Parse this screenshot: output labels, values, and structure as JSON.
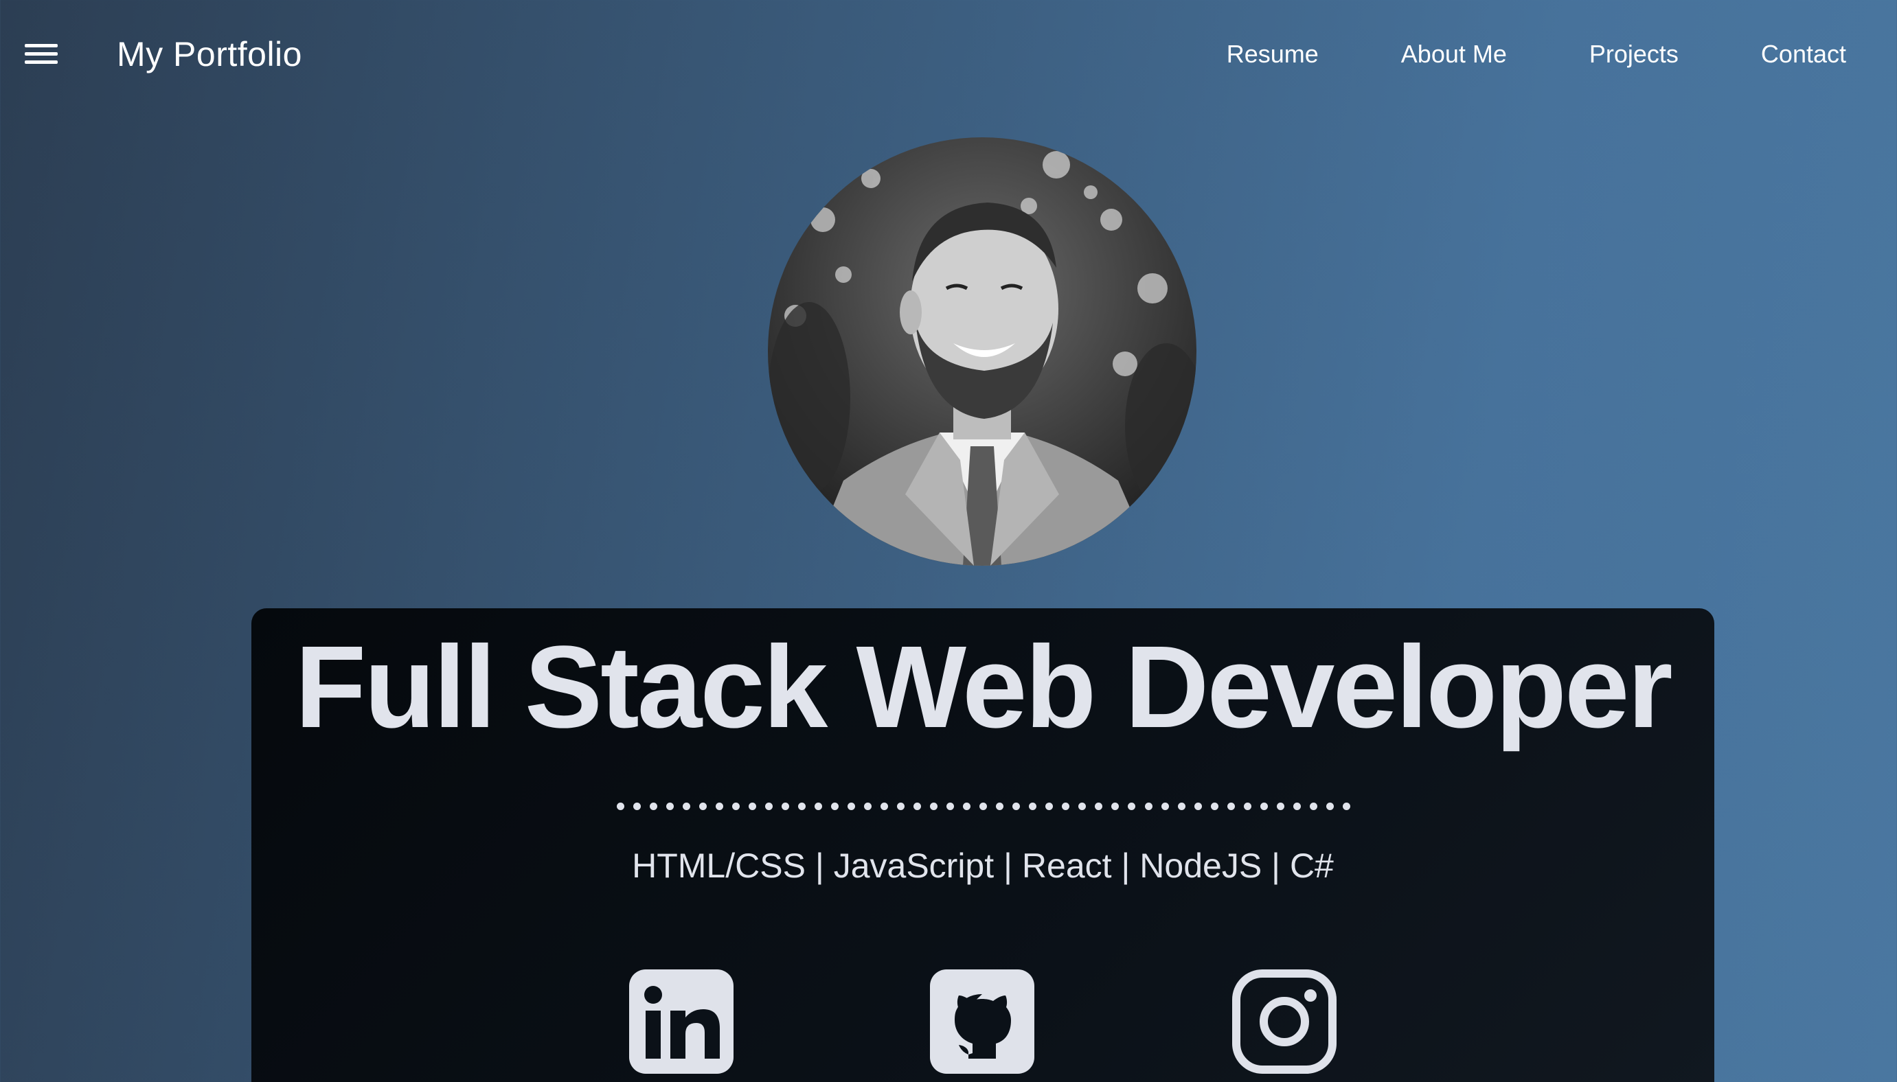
{
  "header": {
    "brand": "My Portfolio",
    "menu_icon": "hamburger-menu-icon",
    "nav": [
      {
        "label": "Resume"
      },
      {
        "label": "About Me"
      },
      {
        "label": "Projects"
      },
      {
        "label": "Contact"
      }
    ]
  },
  "hero": {
    "title": "Full Stack Web Developer",
    "skills": "HTML/CSS | JavaScript | React | NodeJS | C#",
    "social": [
      {
        "icon": "linkedin-icon"
      },
      {
        "icon": "github-icon"
      },
      {
        "icon": "instagram-icon"
      }
    ]
  },
  "colors": {
    "background_start": "#2c3e53",
    "background_end": "#4a77a0",
    "card": "#0b1118",
    "text": "#e1e4ec"
  }
}
